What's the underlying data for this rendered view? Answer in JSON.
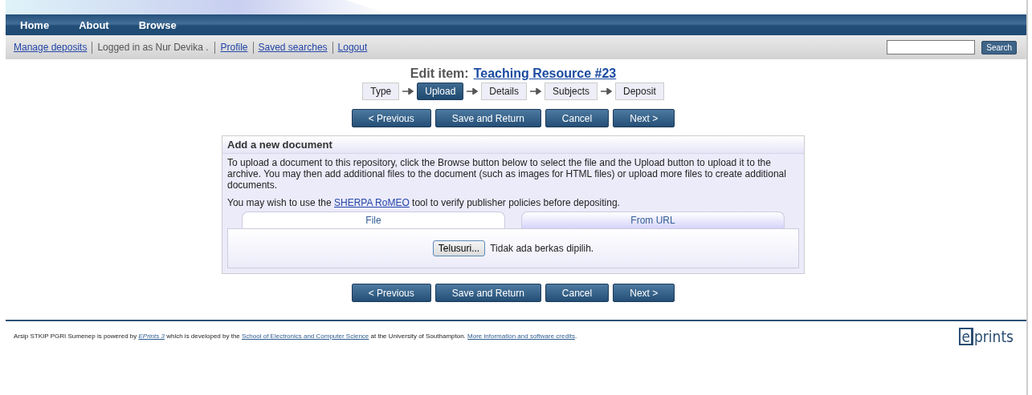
{
  "nav": [
    "Home",
    "About",
    "Browse"
  ],
  "user_bar": {
    "items": [
      {
        "kind": "link",
        "text": "Manage deposits"
      },
      {
        "kind": "text",
        "text": "Logged in as Nur Devika ."
      },
      {
        "kind": "link",
        "text": "Profile"
      },
      {
        "kind": "link",
        "text": "Saved searches"
      },
      {
        "kind": "link",
        "text": "Logout"
      }
    ],
    "search_button": "Search"
  },
  "title": {
    "label": "Edit item:",
    "item": "Teaching Resource #23"
  },
  "stages": [
    {
      "label": "Type",
      "selected": false
    },
    {
      "label": "Upload",
      "selected": true
    },
    {
      "label": "Details",
      "selected": false
    },
    {
      "label": "Subjects",
      "selected": false
    },
    {
      "label": "Deposit",
      "selected": false
    }
  ],
  "buttons_top": [
    "< Previous",
    "Save and Return",
    "Cancel",
    "Next >"
  ],
  "panel": {
    "title": "Add a new document",
    "intro": "To upload a document to this repository, click the Browse button below to select the file and the Upload button to upload it to the archive. You may then add additional files to the document (such as images for HTML files) or upload more files to create additional documents.",
    "note": [
      {
        "kind": "text",
        "text": "You may wish to use the "
      },
      {
        "kind": "link",
        "text": "SHERPA RoMEO"
      },
      {
        "kind": "text",
        "text": " tool to verify publisher policies before depositing."
      }
    ],
    "tabs": [
      {
        "label": "File",
        "selected": true
      },
      {
        "label": "From URL",
        "selected": false
      }
    ],
    "browse_button": "Telusuri...",
    "file_status": "Tidak ada berkas dipilih."
  },
  "buttons_bottom": [
    "< Previous",
    "Save and Return",
    "Cancel",
    "Next >"
  ],
  "footer": {
    "text": [
      {
        "kind": "text",
        "text": "Arsip STKIP PGRI Sumenep is powered by "
      },
      {
        "kind": "em-link",
        "text": "EPrints 3"
      },
      {
        "kind": "text",
        "text": " which is developed by the "
      },
      {
        "kind": "link",
        "text": "School of Electronics and Computer Science"
      },
      {
        "kind": "text",
        "text": " at the University of Southampton. "
      },
      {
        "kind": "link",
        "text": "More information and software credits"
      },
      {
        "kind": "text",
        "text": "."
      }
    ],
    "logo": "eprints"
  }
}
